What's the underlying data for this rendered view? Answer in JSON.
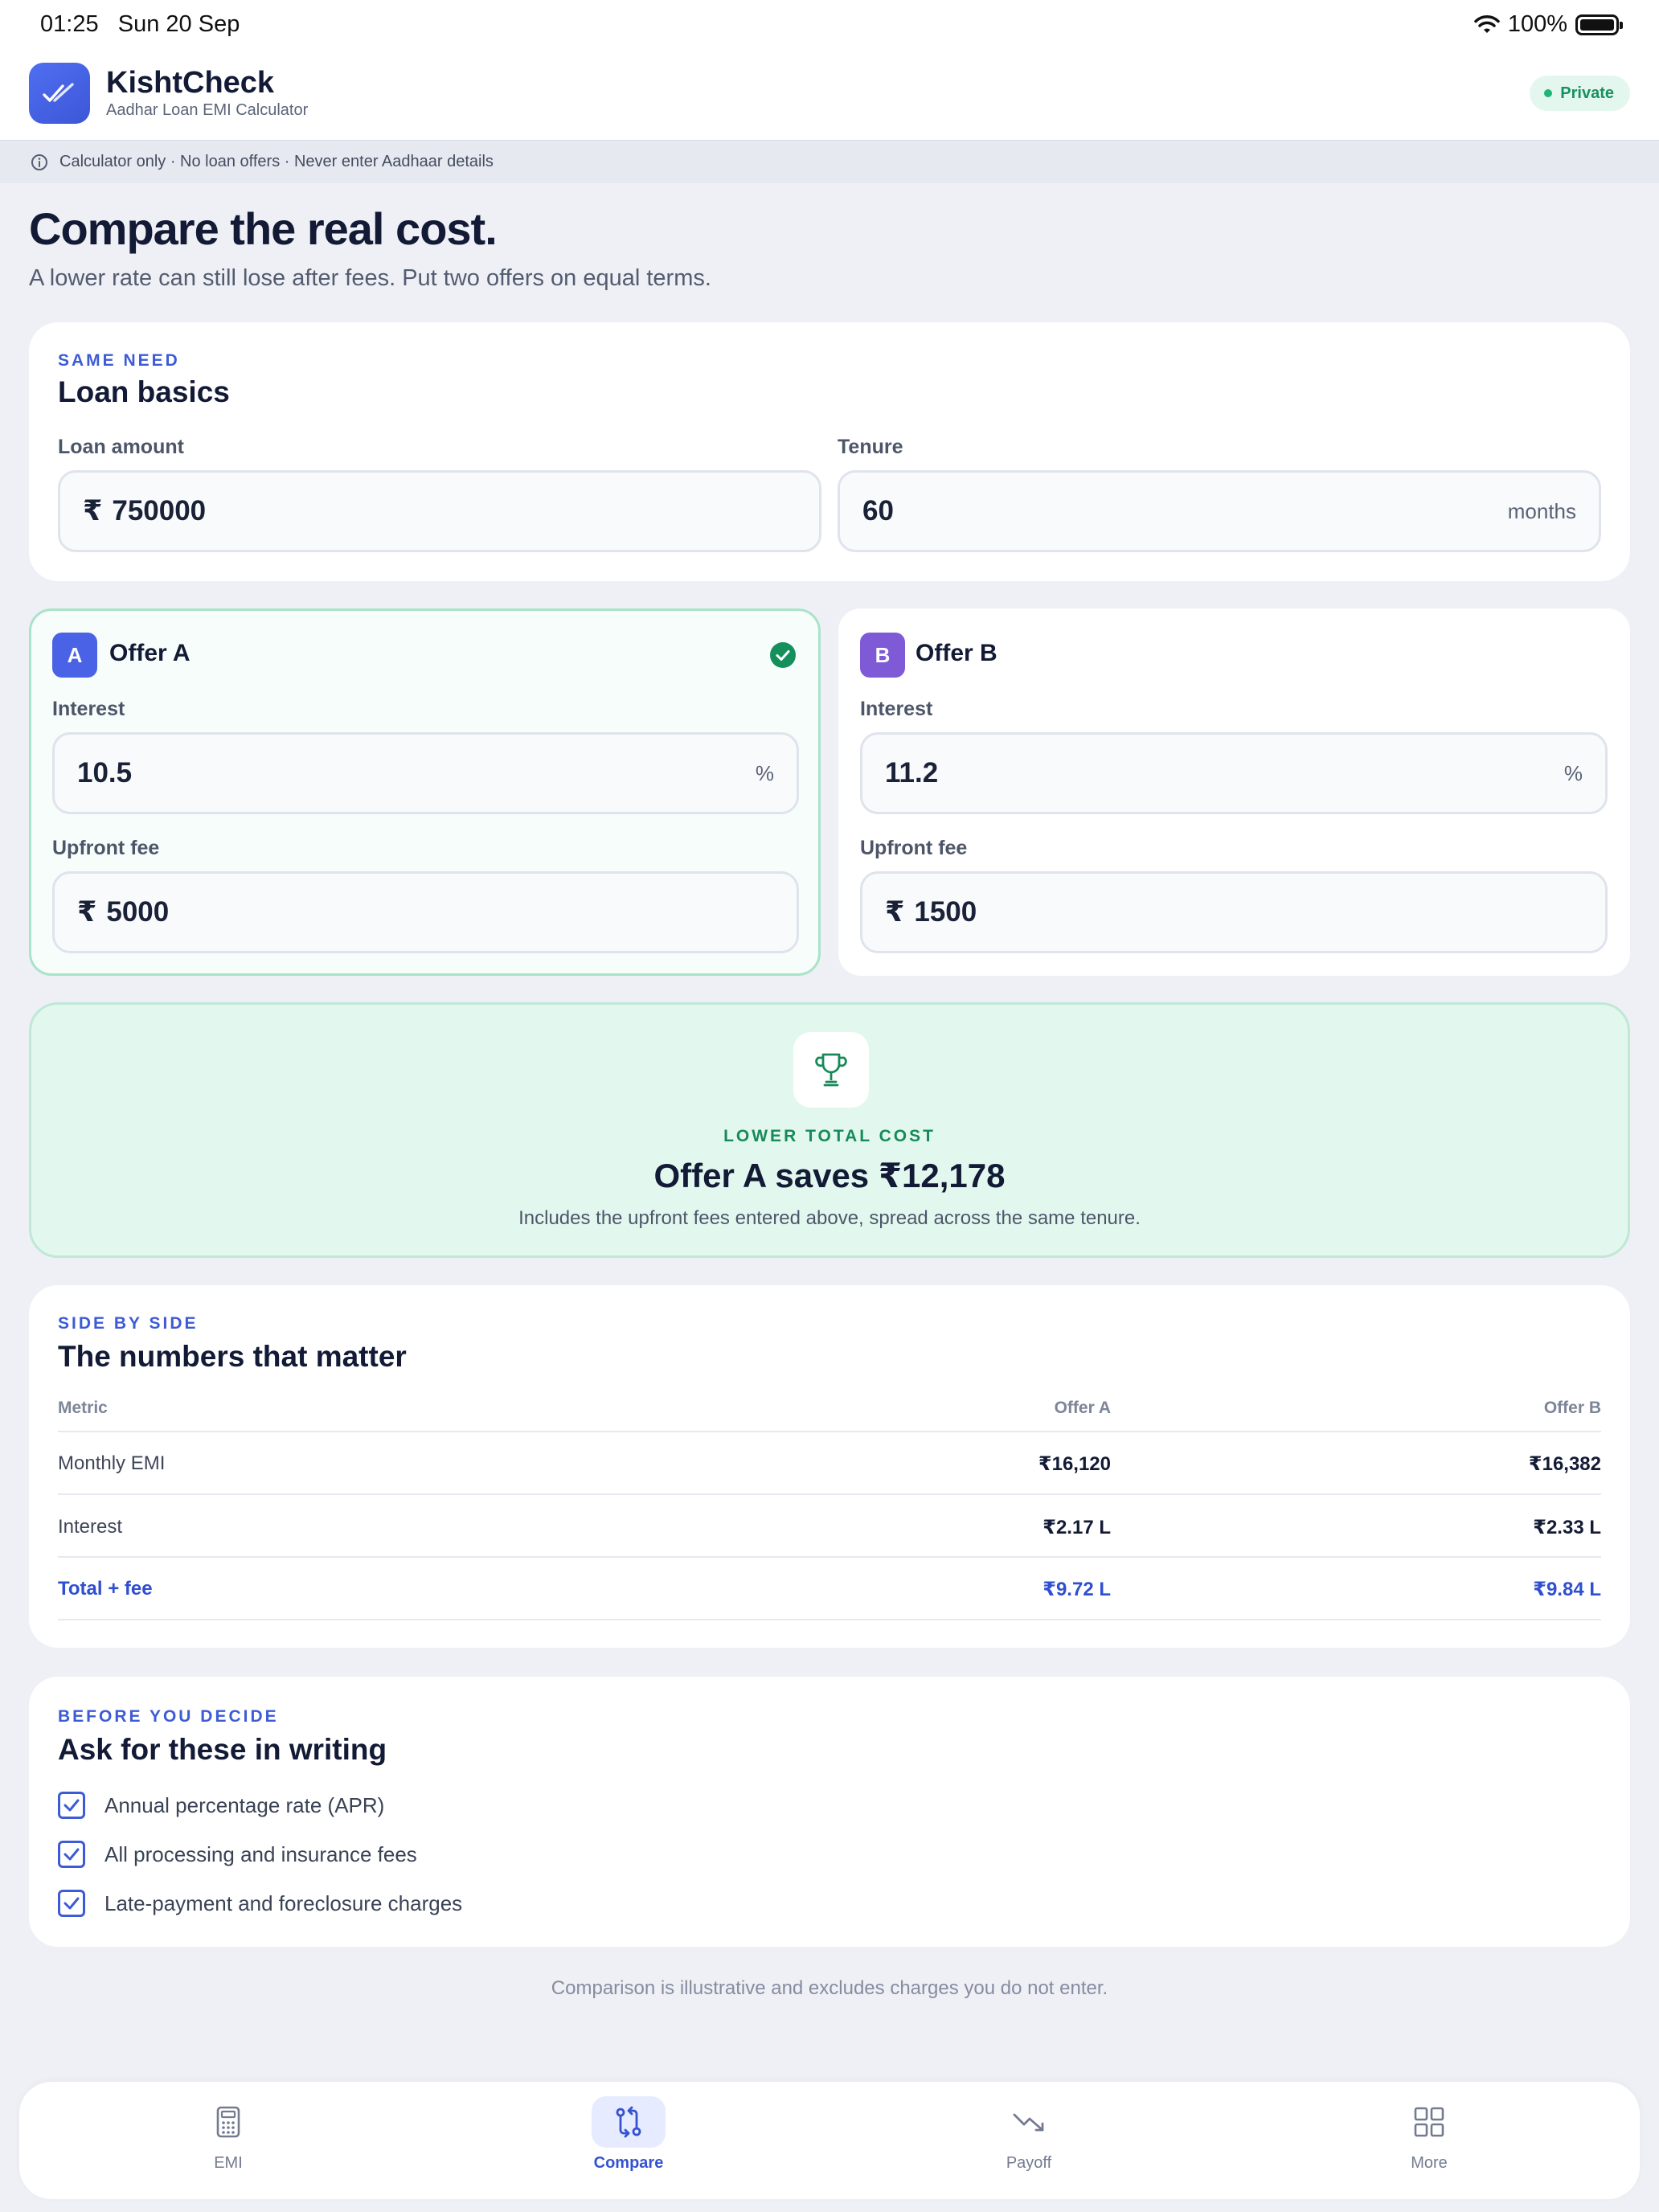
{
  "status_bar": {
    "time": "01:25",
    "date": "Sun 20 Sep",
    "battery": "100%"
  },
  "header": {
    "app_name": "KishtCheck",
    "app_subtitle": "Aadhar Loan EMI Calculator",
    "badge": "Private",
    "icon": "double-check-icon"
  },
  "notice": {
    "text": "Calculator only · No loan offers · Never enter Aadhaar details"
  },
  "hero": {
    "title": "Compare the real cost.",
    "subtitle": "A lower rate can still lose after fees. Put two offers on equal terms."
  },
  "basics": {
    "eyebrow": "SAME NEED",
    "title": "Loan basics",
    "amount_label": "Loan amount",
    "currency": "₹",
    "amount_value": "750000",
    "tenure_label": "Tenure",
    "tenure_value": "60",
    "tenure_unit": "months"
  },
  "offer_a": {
    "badge": "A",
    "title": "Offer A",
    "selected": true,
    "interest_label": "Interest",
    "interest_value": "10.5",
    "interest_unit": "%",
    "fee_label": "Upfront fee",
    "fee_currency": "₹",
    "fee_value": "5000",
    "accent": "#4a63e6"
  },
  "offer_b": {
    "badge": "B",
    "title": "Offer B",
    "interest_label": "Interest",
    "interest_value": "11.2",
    "interest_unit": "%",
    "fee_label": "Upfront fee",
    "fee_currency": "₹",
    "fee_value": "1500",
    "accent": "#7e5ad6"
  },
  "winner": {
    "eyebrow": "LOWER TOTAL COST",
    "title": "Offer A saves ₹12,178",
    "note": "Includes the upfront fees entered above, spread across the same tenure.",
    "icon": "trophy-icon"
  },
  "comparison": {
    "eyebrow": "SIDE BY SIDE",
    "title": "The numbers that matter",
    "headers": [
      "Metric",
      "Offer A",
      "Offer B"
    ],
    "rows": [
      {
        "metric": "Monthly EMI",
        "a": "₹16,120",
        "b": "₹16,382"
      },
      {
        "metric": "Interest",
        "a": "₹2.17 L",
        "b": "₹2.33 L"
      },
      {
        "metric": "Total + fee",
        "a": "₹9.72 L",
        "b": "₹9.84 L"
      }
    ]
  },
  "checklist": {
    "eyebrow": "BEFORE YOU DECIDE",
    "title": "Ask for these in writing",
    "items": [
      "Annual percentage rate (APR)",
      "All processing and insurance fees",
      "Late-payment and foreclosure charges"
    ]
  },
  "footnote": "Comparison is illustrative and excludes charges you do not enter.",
  "tabs": [
    {
      "label": "EMI",
      "icon": "calculator-icon",
      "active": false
    },
    {
      "label": "Compare",
      "icon": "compare-arrows-icon",
      "active": true
    },
    {
      "label": "Payoff",
      "icon": "trend-down-icon",
      "active": false
    },
    {
      "label": "More",
      "icon": "grid-icon",
      "active": false
    }
  ],
  "colors": {
    "primary": "#3d5bd6",
    "success": "#178a5a",
    "background": "#eef0f5"
  }
}
